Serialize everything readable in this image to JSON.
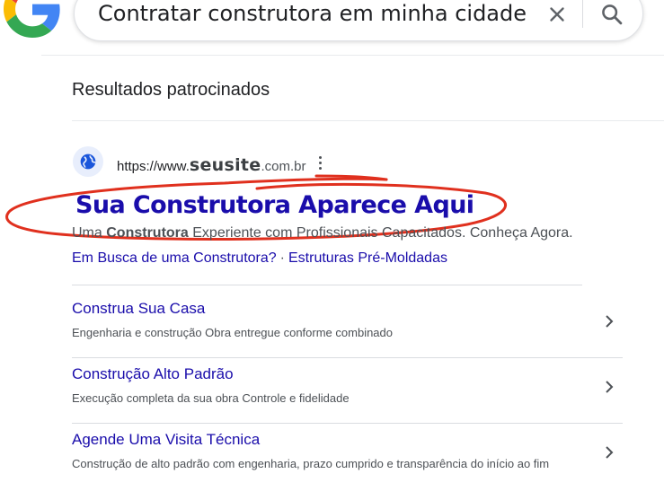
{
  "search": {
    "query": "Contratar construtora em minha cidade",
    "clear_icon": "close-icon",
    "search_icon": "search-icon"
  },
  "logo": {
    "icon": "google-g-logo",
    "colors": [
      "#4285F4",
      "#EA4335",
      "#FBBC05",
      "#34A853"
    ]
  },
  "sponsored": {
    "heading": "Resultados patrocinados"
  },
  "ad": {
    "favicon": "globe-icon",
    "url_prefix": "https://www.",
    "url_brand": "seusite",
    "url_suffix": ".com.br",
    "title": "Sua Construtora Aparece Aqui",
    "desc_before": "Uma ",
    "desc_bold": "Construtora",
    "desc_after": " Experiente com Profissionais Capacitados. Conheça Agora.",
    "inline_links": [
      "Em Busca de uma Construtora?",
      "Estruturas Pré-Moldadas"
    ],
    "inline_separator": "·",
    "annotation_color": "#e0301e"
  },
  "sitelinks": [
    {
      "title": "Construa Sua Casa",
      "desc": "Engenharia e construção Obra entregue conforme combinado"
    },
    {
      "title": "Construção Alto Padrão",
      "desc": "Execução completa da sua obra Controle e fidelidade"
    },
    {
      "title": "Agende Uma Visita Técnica",
      "desc": "Construção de alto padrão com engenharia, prazo cumprido e transparência do início ao fim"
    }
  ],
  "colors": {
    "link": "#1a0dab",
    "text": "#202124",
    "muted": "#4d5156"
  }
}
